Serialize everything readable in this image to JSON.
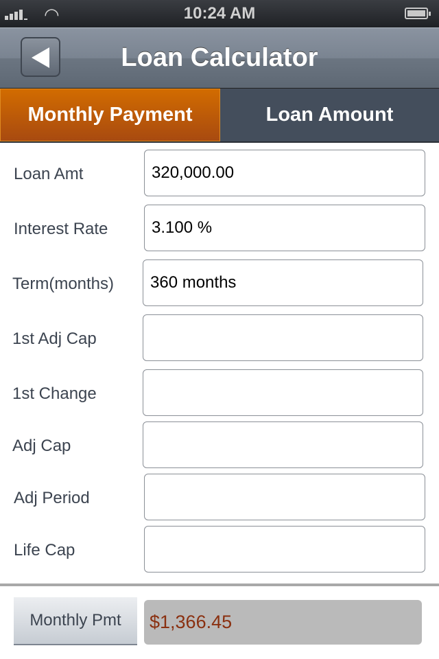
{
  "status_bar": {
    "time": "10:24 AM",
    "signal_icon": "signal-bars-icon",
    "wifi_icon": "wifi-icon",
    "battery_icon": "battery-icon"
  },
  "nav": {
    "title": "Loan Calculator",
    "back_icon": "back-arrow-icon"
  },
  "tabs": [
    {
      "label": "Monthly Payment",
      "active": true
    },
    {
      "label": "Loan Amount",
      "active": false
    }
  ],
  "colors": {
    "active_tab": "#c8640a",
    "inactive_tab": "#444e5c",
    "result_text": "#8a3010"
  },
  "fields": [
    {
      "label": "Loan Amt",
      "value": "320,000.00"
    },
    {
      "label": "Interest Rate",
      "value": "3.100 %"
    },
    {
      "label": "Term(months)",
      "value": "360 months"
    },
    {
      "label": "1st Adj Cap",
      "value": ""
    },
    {
      "label": "1st Change",
      "value": ""
    },
    {
      "label": "Adj Cap",
      "value": ""
    },
    {
      "label": "Adj Period",
      "value": ""
    },
    {
      "label": "Life Cap",
      "value": ""
    }
  ],
  "result": {
    "button_label": "Monthly Pmt",
    "value": "$1,366.45"
  }
}
